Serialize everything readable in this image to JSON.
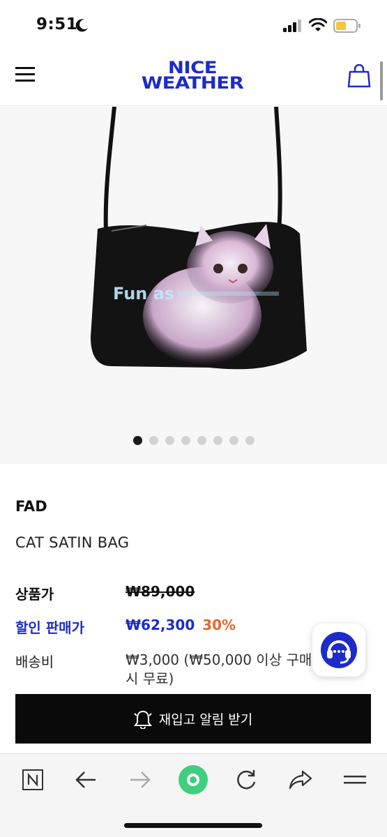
{
  "status_bar": {
    "time": "9:51",
    "icons": [
      "moon-icon",
      "signal-icon",
      "wifi-icon",
      "battery-icon"
    ]
  },
  "header": {
    "logo_line1": "NICE",
    "logo_line2": "WEATHER",
    "brand_color": "#1d2bc9",
    "icons": [
      "menu-icon",
      "cart-icon"
    ]
  },
  "gallery": {
    "print_text": "Fun as",
    "slide_count": 8,
    "active_slide": 1
  },
  "product": {
    "brand": "FAD",
    "name": "CAT SATIN BAG",
    "price_label": "상품가",
    "price_original": "₩89,000",
    "sale_label": "할인 판매가",
    "sale_price": "₩62,300",
    "discount": "30%",
    "shipping_label": "배송비",
    "shipping_value": "₩3,000 (₩50,000 이상 구매 시 무료)"
  },
  "actions": {
    "restock_label": "재입고 알림 받기",
    "chat_icon": "headset-icon"
  },
  "browser_toolbar": {
    "items": [
      "n-icon",
      "back-arrow-icon",
      "forward-arrow-icon",
      "home-icon",
      "reload-icon",
      "share-icon",
      "menu-lines-icon"
    ]
  },
  "colors": {
    "accent": "#1d2bc9",
    "discount": "#e06a2c",
    "home_green": "#3fcf7e"
  }
}
